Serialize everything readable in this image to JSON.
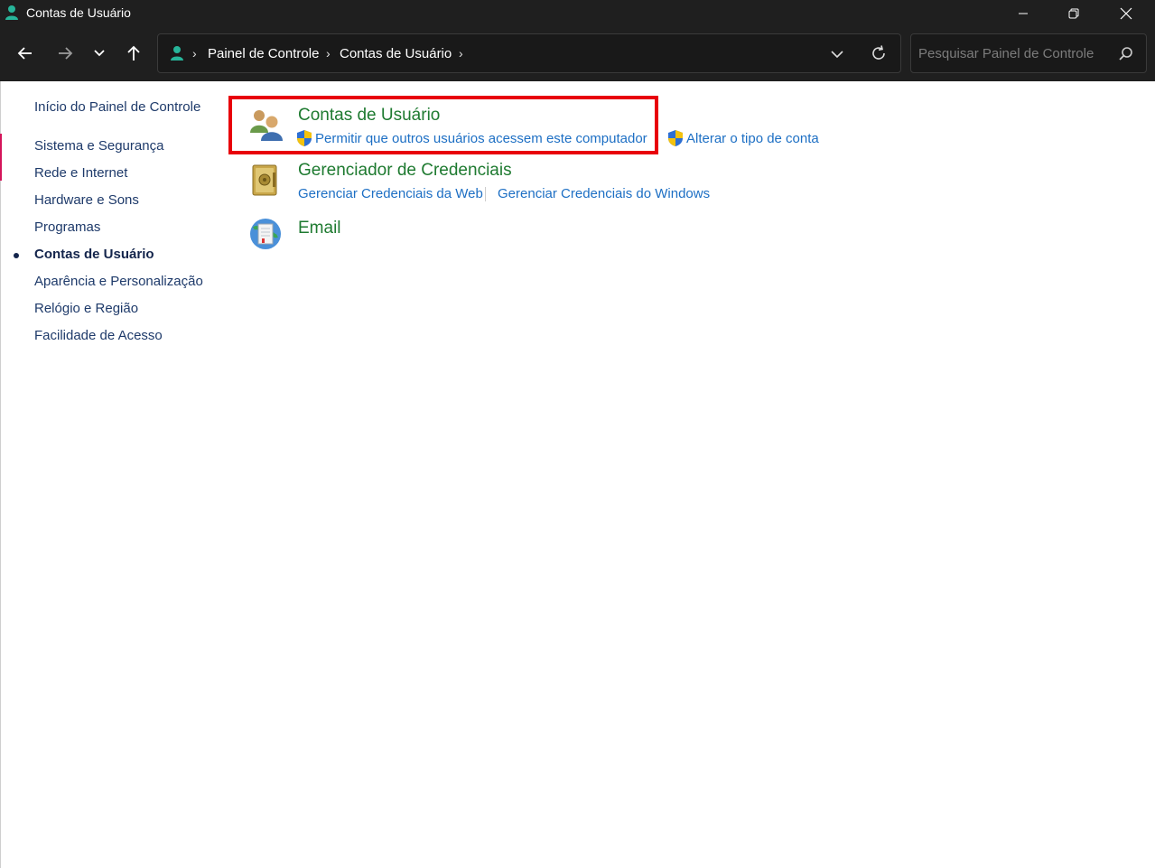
{
  "window": {
    "title": "Contas de Usuário",
    "app_icon": "user-accounts-icon"
  },
  "navigation": {
    "back_icon": "back-arrow-icon",
    "forward_icon": "forward-arrow-icon",
    "recent_icon": "chevron-down-icon",
    "up_icon": "up-arrow-icon"
  },
  "address_bar": {
    "breadcrumbs": [
      "Painel de Controle",
      "Contas de Usuário"
    ]
  },
  "search": {
    "placeholder": "Pesquisar Painel de Controle"
  },
  "sidebar": {
    "home": "Início do Painel de Controle",
    "items": [
      {
        "label": "Sistema e Segurança"
      },
      {
        "label": "Rede e Internet"
      },
      {
        "label": "Hardware e Sons"
      },
      {
        "label": "Programas"
      },
      {
        "label": "Contas de Usuário",
        "active": true
      },
      {
        "label": "Aparência e Personalização"
      },
      {
        "label": "Relógio e Região"
      },
      {
        "label": "Facilidade de Acesso"
      }
    ]
  },
  "categories": [
    {
      "title": "Contas de Usuário",
      "icon": "user-accounts-icon",
      "links": [
        {
          "label": "Permitir que outros usuários acessem este computador",
          "shield": true
        },
        {
          "label": "Alterar o tipo de conta",
          "shield": true
        }
      ]
    },
    {
      "title": "Gerenciador de Credenciais",
      "icon": "credential-vault-icon",
      "links": [
        {
          "label": "Gerenciar Credenciais da Web"
        },
        {
          "label": "Gerenciar Credenciais do Windows"
        }
      ]
    },
    {
      "title": "Email",
      "icon": "mail-globe-icon",
      "links": []
    }
  ],
  "colors": {
    "titlebar_bg": "#1f1f1f",
    "category_title": "#1e7a30",
    "link": "#1d6fc4",
    "sidebar_text": "#1e3a6a",
    "highlight": "#e8000b"
  }
}
